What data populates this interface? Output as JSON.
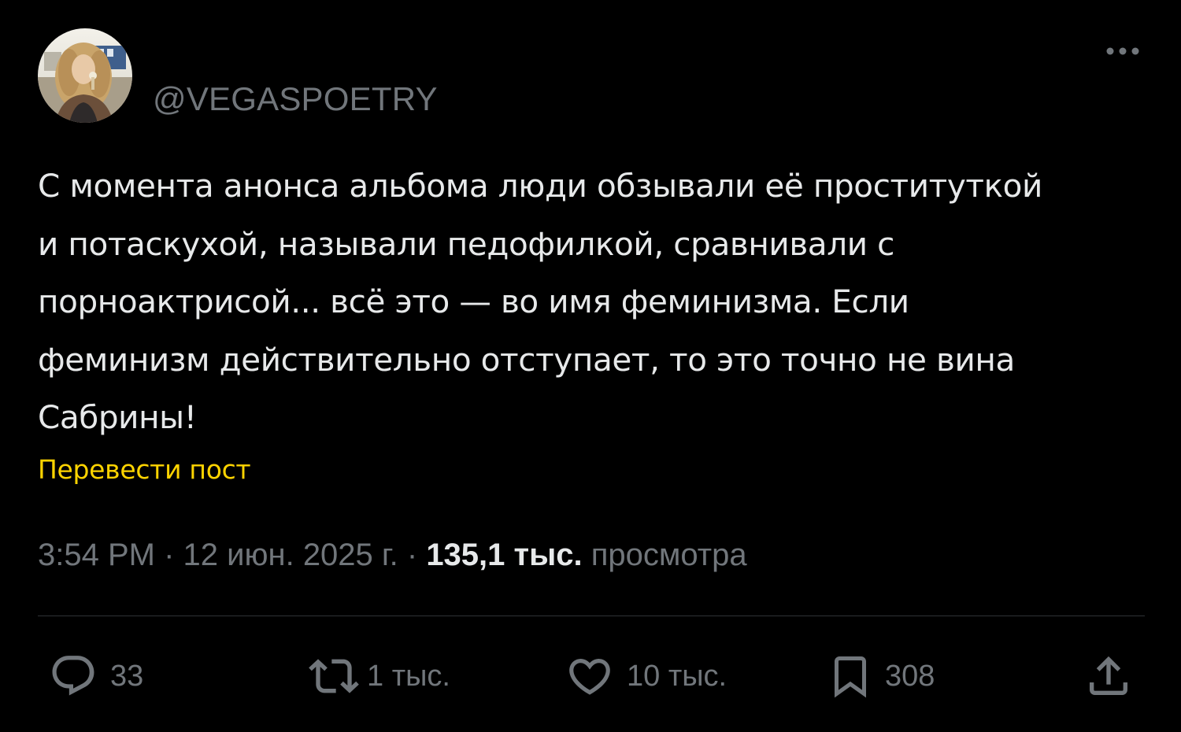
{
  "post": {
    "handle": "@VEGASPOETRY",
    "text_lines": [
      "С момента анонса альбома люди обзывали её проституткой",
      "и потаскухой, называли педофилкой, сравнивали с",
      "порноактрисой... всё это — во имя феминизма. Если",
      "феминизм действительно отступает, то это точно не вина",
      "Сабрины!"
    ],
    "translate_label": "Перевести пост",
    "time": "3:54 PM",
    "separator": "·",
    "date": "12 июн. 2025 г.",
    "views_count": "135,1 тыс.",
    "views_label": "просмотра"
  },
  "actions": {
    "replies": {
      "icon": "reply-icon",
      "count": "33"
    },
    "reposts": {
      "icon": "repost-icon",
      "count": "1 тыс."
    },
    "likes": {
      "icon": "heart-icon",
      "count": "10 тыс."
    },
    "bookmarks": {
      "icon": "bookmark-icon",
      "count": "308"
    },
    "share": {
      "icon": "share-icon"
    }
  },
  "colors": {
    "background": "#000000",
    "text": "#e7e9ea",
    "muted": "#71767b",
    "link": "#ffd400",
    "divider": "#2f3336"
  }
}
